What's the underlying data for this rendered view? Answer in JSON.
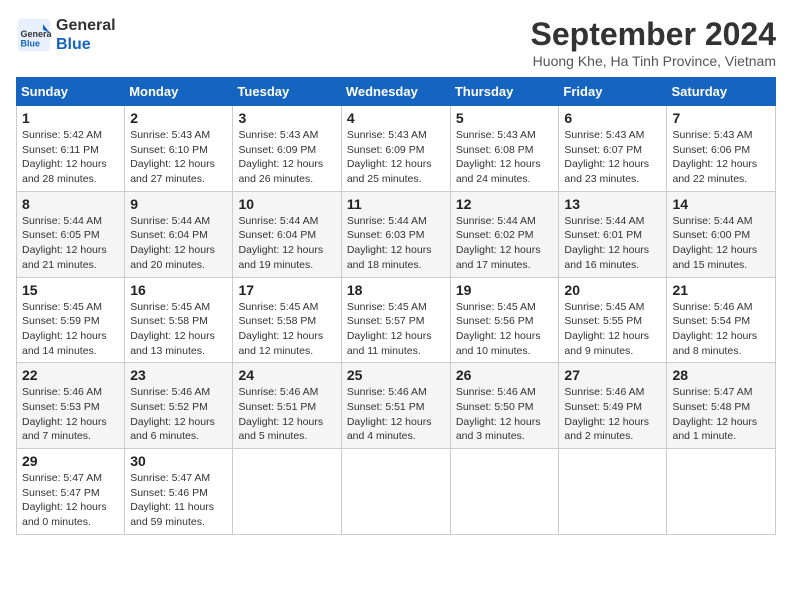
{
  "header": {
    "logo_line1": "General",
    "logo_line2": "Blue",
    "month": "September 2024",
    "location": "Huong Khe, Ha Tinh Province, Vietnam"
  },
  "weekdays": [
    "Sunday",
    "Monday",
    "Tuesday",
    "Wednesday",
    "Thursday",
    "Friday",
    "Saturday"
  ],
  "weeks": [
    [
      {
        "day": "1",
        "sunrise": "5:42 AM",
        "sunset": "6:11 PM",
        "daylight": "12 hours and 28 minutes."
      },
      {
        "day": "2",
        "sunrise": "5:43 AM",
        "sunset": "6:10 PM",
        "daylight": "12 hours and 27 minutes."
      },
      {
        "day": "3",
        "sunrise": "5:43 AM",
        "sunset": "6:09 PM",
        "daylight": "12 hours and 26 minutes."
      },
      {
        "day": "4",
        "sunrise": "5:43 AM",
        "sunset": "6:09 PM",
        "daylight": "12 hours and 25 minutes."
      },
      {
        "day": "5",
        "sunrise": "5:43 AM",
        "sunset": "6:08 PM",
        "daylight": "12 hours and 24 minutes."
      },
      {
        "day": "6",
        "sunrise": "5:43 AM",
        "sunset": "6:07 PM",
        "daylight": "12 hours and 23 minutes."
      },
      {
        "day": "7",
        "sunrise": "5:43 AM",
        "sunset": "6:06 PM",
        "daylight": "12 hours and 22 minutes."
      }
    ],
    [
      {
        "day": "8",
        "sunrise": "5:44 AM",
        "sunset": "6:05 PM",
        "daylight": "12 hours and 21 minutes."
      },
      {
        "day": "9",
        "sunrise": "5:44 AM",
        "sunset": "6:04 PM",
        "daylight": "12 hours and 20 minutes."
      },
      {
        "day": "10",
        "sunrise": "5:44 AM",
        "sunset": "6:04 PM",
        "daylight": "12 hours and 19 minutes."
      },
      {
        "day": "11",
        "sunrise": "5:44 AM",
        "sunset": "6:03 PM",
        "daylight": "12 hours and 18 minutes."
      },
      {
        "day": "12",
        "sunrise": "5:44 AM",
        "sunset": "6:02 PM",
        "daylight": "12 hours and 17 minutes."
      },
      {
        "day": "13",
        "sunrise": "5:44 AM",
        "sunset": "6:01 PM",
        "daylight": "12 hours and 16 minutes."
      },
      {
        "day": "14",
        "sunrise": "5:44 AM",
        "sunset": "6:00 PM",
        "daylight": "12 hours and 15 minutes."
      }
    ],
    [
      {
        "day": "15",
        "sunrise": "5:45 AM",
        "sunset": "5:59 PM",
        "daylight": "12 hours and 14 minutes."
      },
      {
        "day": "16",
        "sunrise": "5:45 AM",
        "sunset": "5:58 PM",
        "daylight": "12 hours and 13 minutes."
      },
      {
        "day": "17",
        "sunrise": "5:45 AM",
        "sunset": "5:58 PM",
        "daylight": "12 hours and 12 minutes."
      },
      {
        "day": "18",
        "sunrise": "5:45 AM",
        "sunset": "5:57 PM",
        "daylight": "12 hours and 11 minutes."
      },
      {
        "day": "19",
        "sunrise": "5:45 AM",
        "sunset": "5:56 PM",
        "daylight": "12 hours and 10 minutes."
      },
      {
        "day": "20",
        "sunrise": "5:45 AM",
        "sunset": "5:55 PM",
        "daylight": "12 hours and 9 minutes."
      },
      {
        "day": "21",
        "sunrise": "5:46 AM",
        "sunset": "5:54 PM",
        "daylight": "12 hours and 8 minutes."
      }
    ],
    [
      {
        "day": "22",
        "sunrise": "5:46 AM",
        "sunset": "5:53 PM",
        "daylight": "12 hours and 7 minutes."
      },
      {
        "day": "23",
        "sunrise": "5:46 AM",
        "sunset": "5:52 PM",
        "daylight": "12 hours and 6 minutes."
      },
      {
        "day": "24",
        "sunrise": "5:46 AM",
        "sunset": "5:51 PM",
        "daylight": "12 hours and 5 minutes."
      },
      {
        "day": "25",
        "sunrise": "5:46 AM",
        "sunset": "5:51 PM",
        "daylight": "12 hours and 4 minutes."
      },
      {
        "day": "26",
        "sunrise": "5:46 AM",
        "sunset": "5:50 PM",
        "daylight": "12 hours and 3 minutes."
      },
      {
        "day": "27",
        "sunrise": "5:46 AM",
        "sunset": "5:49 PM",
        "daylight": "12 hours and 2 minutes."
      },
      {
        "day": "28",
        "sunrise": "5:47 AM",
        "sunset": "5:48 PM",
        "daylight": "12 hours and 1 minute."
      }
    ],
    [
      {
        "day": "29",
        "sunrise": "5:47 AM",
        "sunset": "5:47 PM",
        "daylight": "12 hours and 0 minutes."
      },
      {
        "day": "30",
        "sunrise": "5:47 AM",
        "sunset": "5:46 PM",
        "daylight": "11 hours and 59 minutes."
      },
      null,
      null,
      null,
      null,
      null
    ]
  ]
}
